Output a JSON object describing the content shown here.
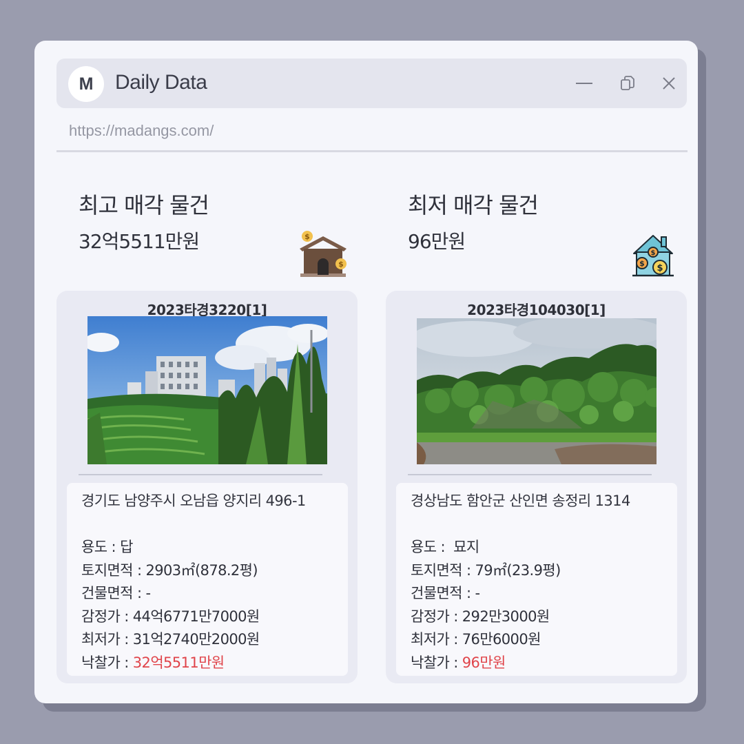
{
  "app": {
    "logo_letter": "M",
    "title": "Daily Data",
    "url": "https://madangs.com/"
  },
  "highest": {
    "heading": "최고 매각 물건",
    "price": "32억5511만원",
    "case_no": "2023타경3220[1]",
    "address": "경기도 남양주시 오남읍 양지리 496-1",
    "usage_label": "용도 : ",
    "usage": "답",
    "land_label": "토지면적 : ",
    "land_area": "2903㎡(878.2평)",
    "building_label": "건물면적 : ",
    "building_area": "-",
    "appraisal_label": "감정가 : ",
    "appraisal": "44억6771만7000원",
    "minimum_label": "최저가 : ",
    "minimum": "31억2740만2000원",
    "winning_label": "낙찰가 : ",
    "winning": "32억5511만원"
  },
  "lowest": {
    "heading": "최저 매각 물건",
    "price": "96만원",
    "case_no": "2023타경104030[1]",
    "address": "경상남도 함안군 산인면 송정리 1314",
    "usage_label": "용도 : ",
    "usage": " 묘지",
    "land_label": "토지면적 : ",
    "land_area": "79㎡(23.9평)",
    "building_label": "건물면적 : ",
    "building_area": "-",
    "appraisal_label": "감정가 : ",
    "appraisal": "292만3000원",
    "minimum_label": "최저가 : ",
    "minimum": "76만6000원",
    "winning_label": "낙찰가 : ",
    "winning": "96만원"
  },
  "colors": {
    "background": "#9a9cae",
    "window": "#f5f6fb",
    "titlebar": "#e4e5ee",
    "card": "#e9eaf3",
    "price_highlight": "#e0444a"
  },
  "icons": {
    "minimize": "minimize-icon",
    "restore": "restore-icon",
    "close": "close-icon",
    "house_money_left": "house-money-icon",
    "house_money_right": "house-coins-icon"
  }
}
